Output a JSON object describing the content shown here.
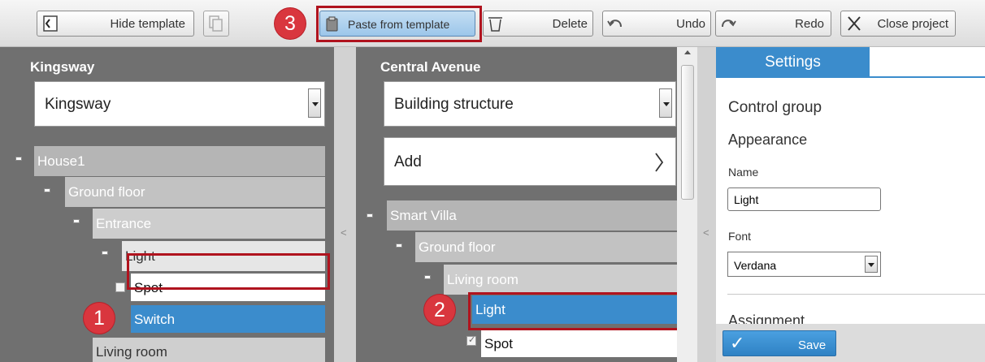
{
  "toolbar": {
    "hide_template_label": "Hide template",
    "paste_label": "Paste from template",
    "delete_label": "Delete",
    "undo_label": "Undo",
    "redo_label": "Redo",
    "close_project_label": "Close project"
  },
  "callouts": {
    "one": "1",
    "two": "2",
    "three": "3"
  },
  "template_panel": {
    "title": "Kingsway",
    "select_value": "Kingsway",
    "tree": {
      "house": "House1",
      "ground_floor": "Ground floor",
      "entrance": "Entrance",
      "light": "Light",
      "spot": "Spot",
      "switch": "Switch",
      "living_room": "Living room"
    }
  },
  "project_panel": {
    "title": "Central Avenue",
    "select_value": "Building structure",
    "add_label": "Add",
    "tree": {
      "villa": "Smart Villa",
      "ground_floor": "Ground floor",
      "living_room": "Living room",
      "light": "Light",
      "spot": "Spot"
    }
  },
  "settings": {
    "tab_label": "Settings",
    "heading": "Control group",
    "appearance_label": "Appearance",
    "name_label": "Name",
    "name_value": "Light",
    "font_label": "Font",
    "font_value": "Verdana",
    "assignment_label": "Assignment",
    "save_label": "Save"
  },
  "colors": {
    "accent": "#3b8ccc",
    "callout": "#d9363e",
    "highlight": "#b0131e",
    "panel": "#707070"
  }
}
